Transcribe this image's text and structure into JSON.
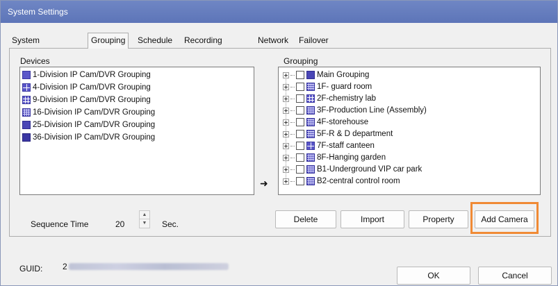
{
  "window": {
    "title": "System Settings"
  },
  "tabs": [
    {
      "label": "System Settings"
    },
    {
      "label": "Grouping"
    },
    {
      "label": "Schedule"
    },
    {
      "label": "Recording Time"
    },
    {
      "label": "Network"
    },
    {
      "label": "Failover"
    }
  ],
  "devices": {
    "label": "Devices",
    "items": [
      {
        "label": "1-Division IP Cam/DVR Grouping",
        "icon": "single-view-icon"
      },
      {
        "label": "4-Division IP Cam/DVR Grouping",
        "icon": "quad-view-icon"
      },
      {
        "label": "9-Division IP Cam/DVR Grouping",
        "icon": "nine-view-icon"
      },
      {
        "label": "16-Division IP Cam/DVR Grouping",
        "icon": "sixteen-view-icon"
      },
      {
        "label": "25-Division IP Cam/DVR Grouping",
        "icon": "twentyfive-view-icon"
      },
      {
        "label": "36-Division IP Cam/DVR Grouping",
        "icon": "thirtysix-view-icon"
      }
    ]
  },
  "grouping": {
    "label": "Grouping",
    "items": [
      {
        "label": "Main Grouping"
      },
      {
        "label": "1F- guard room"
      },
      {
        "label": "2F-chemistry lab"
      },
      {
        "label": "3F-Production Line (Assembly)"
      },
      {
        "label": "4F-storehouse"
      },
      {
        "label": "5F-R & D department"
      },
      {
        "label": "7F-staff canteen"
      },
      {
        "label": "8F-Hanging garden"
      },
      {
        "label": "B1-Underground VIP car park"
      },
      {
        "label": "B2-central control room"
      }
    ]
  },
  "transfer_arrow": "➜",
  "sequence": {
    "label": "Sequence Time",
    "value": "20",
    "unit": "Sec."
  },
  "buttons": {
    "delete": "Delete",
    "import": "Import",
    "property": "Property",
    "add_camera": "Add Camera",
    "ok": "OK",
    "cancel": "Cancel"
  },
  "guid": {
    "label": "GUID:",
    "visible_prefix": "2"
  },
  "colors": {
    "titlebar": "#6f86c4",
    "highlight": "#f08a35",
    "icon": "#5b57c9"
  }
}
